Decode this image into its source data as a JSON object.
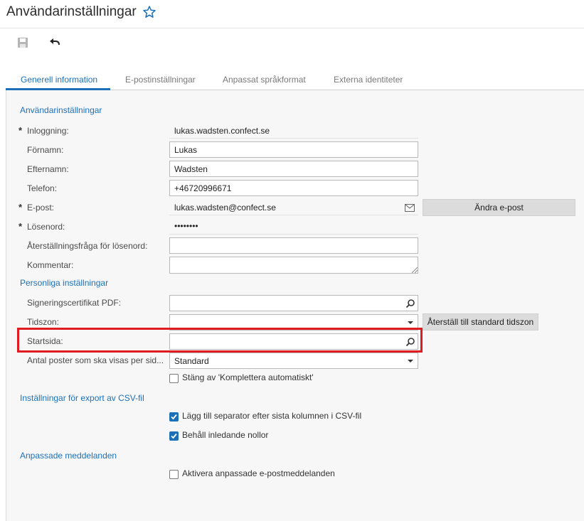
{
  "header": {
    "title": "Användarinställningar",
    "star_icon": "star-outline-icon"
  },
  "toolbar": {
    "save_icon": "save-icon",
    "undo_icon": "undo-icon"
  },
  "tabs": [
    {
      "label": "Generell information",
      "active": true
    },
    {
      "label": "E-postinställningar",
      "active": false
    },
    {
      "label": "Anpassat språkformat",
      "active": false
    },
    {
      "label": "Externa identiteter",
      "active": false
    }
  ],
  "user_settings": {
    "section_title": "Användarinställningar",
    "login": {
      "label": "Inloggning:",
      "value": "lukas.wadsten.confect.se",
      "required": "*"
    },
    "first_name": {
      "label": "Förnamn:",
      "value": "Lukas"
    },
    "last_name": {
      "label": "Efternamn:",
      "value": "Wadsten"
    },
    "phone": {
      "label": "Telefon:",
      "value": "+46720996671"
    },
    "email": {
      "label": "E-post:",
      "value": "lukas.wadsten@confect.se",
      "required": "*",
      "button": "Ändra e-post"
    },
    "password": {
      "label": "Lösenord:",
      "value": "••••••••",
      "required": "*"
    },
    "reset_question": {
      "label": "Återställningsfråga för lösenord:",
      "value": ""
    },
    "comment": {
      "label": "Kommentar:",
      "value": ""
    }
  },
  "personal_settings": {
    "section_title": "Personliga inställningar",
    "pdf_certificate": {
      "label": "Signeringscertifikat PDF:",
      "value": ""
    },
    "timezone": {
      "label": "Tidszon:",
      "value": "",
      "button": "Återställ till standard tidszon"
    },
    "start_page": {
      "label": "Startsida:",
      "value": ""
    },
    "rows_per_page": {
      "label": "Antal poster som ska visas per sid...",
      "value": "Standard"
    },
    "disable_autocomplete": {
      "label": "Stäng av 'Komplettera automatiskt'",
      "checked": false
    }
  },
  "csv_settings": {
    "section_title": "Inställningar för export av CSV-fil",
    "add_separator": {
      "label": "Lägg till separator efter sista kolumnen i CSV-fil",
      "checked": true
    },
    "keep_leading_zeros": {
      "label": "Behåll inledande nollor",
      "checked": true
    }
  },
  "custom_messages": {
    "section_title": "Anpassade meddelanden",
    "enable_custom_emails": {
      "label": "Aktivera anpassade e-postmeddelanden",
      "checked": false
    }
  },
  "colors": {
    "accent": "#1d70b8",
    "highlight": "#e01b22",
    "panel": "#f7f7f8"
  }
}
